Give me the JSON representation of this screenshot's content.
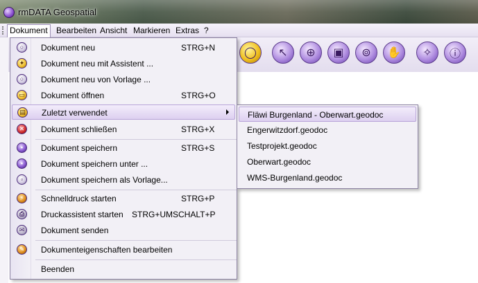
{
  "window": {
    "title": "rmDATA Geospatial"
  },
  "menubar": {
    "items": [
      {
        "label": "Dokument"
      },
      {
        "label": "Bearbeiten"
      },
      {
        "label": "Ansicht"
      },
      {
        "label": "Markieren"
      },
      {
        "label": "Extras"
      },
      {
        "label": "?"
      }
    ]
  },
  "toolbar": {
    "buttons": [
      {
        "icon": "circle-icon"
      },
      {
        "icon": "select-arrow-icon"
      },
      {
        "icon": "zoom-in-icon"
      },
      {
        "icon": "zoom-window-icon"
      },
      {
        "icon": "zoom-plus-icon"
      },
      {
        "icon": "pan-hand-icon"
      },
      {
        "icon": "magic-wand-icon"
      },
      {
        "icon": "info-icon"
      }
    ]
  },
  "dokument_menu": {
    "items": [
      {
        "label": "Dokument neu",
        "shortcut": "STRG+N",
        "icon": "new-document-icon"
      },
      {
        "label": "Dokument neu mit Assistent ...",
        "shortcut": "",
        "icon": "wizard-icon"
      },
      {
        "label": "Dokument neu von Vorlage ...",
        "shortcut": "",
        "icon": "template-icon"
      },
      {
        "label": "Dokument öffnen",
        "shortcut": "STRG+O",
        "icon": "open-folder-icon"
      },
      {
        "label": "Zuletzt verwendet",
        "shortcut": "",
        "icon": "recent-icon"
      },
      {
        "label": "Dokument schließen",
        "shortcut": "STRG+X",
        "icon": "close-document-icon"
      },
      {
        "label": "Dokument speichern",
        "shortcut": "STRG+S",
        "icon": "save-icon"
      },
      {
        "label": "Dokument speichern unter ...",
        "shortcut": "",
        "icon": "save-as-icon"
      },
      {
        "label": "Dokument speichern als Vorlage...",
        "shortcut": "",
        "icon": "save-template-icon"
      },
      {
        "label": "Schnelldruck starten",
        "shortcut": "STRG+P",
        "icon": "quick-print-icon"
      },
      {
        "label": "Druckassistent starten",
        "shortcut": "STRG+UMSCHALT+P",
        "icon": "print-wizard-icon"
      },
      {
        "label": "Dokument senden",
        "shortcut": "",
        "icon": "send-icon"
      },
      {
        "label": "Dokumenteigenschaften bearbeiten",
        "shortcut": "",
        "icon": "properties-icon"
      },
      {
        "label": "Beenden",
        "shortcut": "",
        "icon": ""
      }
    ]
  },
  "recent_submenu": {
    "items": [
      {
        "label": "Fläwi Burgenland - Oberwart.geodoc"
      },
      {
        "label": "Engerwitzdorf.geodoc"
      },
      {
        "label": "Testprojekt.geodoc"
      },
      {
        "label": "Oberwart.geodoc"
      },
      {
        "label": "WMS-Burgenland.geodoc"
      }
    ]
  }
}
